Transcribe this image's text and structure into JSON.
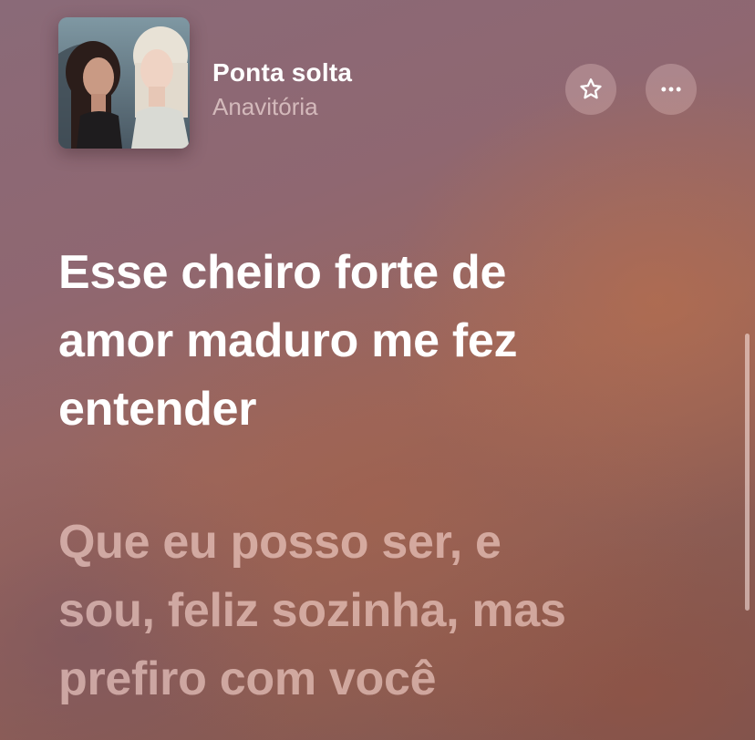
{
  "now_playing": {
    "title": "Ponta solta",
    "artist": "Anavitória",
    "favorite_icon": "star-icon",
    "more_icon": "ellipsis-icon"
  },
  "lyrics": {
    "active": {
      "rows": [
        "Esse cheiro forte de",
        "amor maduro me fez",
        "entender"
      ]
    },
    "next": {
      "rows": [
        "Que eu posso ser, e",
        "sou, feliz sozinha, mas",
        "prefiro com você"
      ]
    }
  },
  "colors": {
    "active_lyric": "#ffffff",
    "upcoming_lyric": "#f3d3cc",
    "button_bg": "#d9b3ad"
  }
}
